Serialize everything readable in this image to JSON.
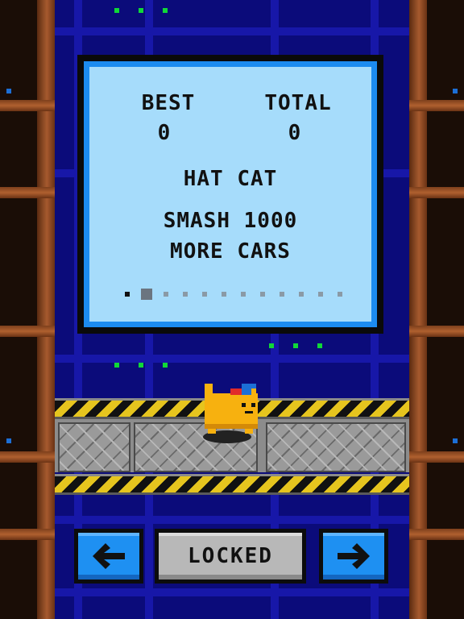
{
  "stats": {
    "best_label": "BEST",
    "best_value": "0",
    "total_label": "TOTAL",
    "total_value": "0"
  },
  "character": {
    "name": "HAT CAT",
    "unlock_line1": "SMASH 1000",
    "unlock_line2": "MORE CARS"
  },
  "pager": {
    "count": 12,
    "current_index": 1
  },
  "controls": {
    "prev_icon": "left-arrow-icon",
    "status_label": "LOCKED",
    "next_icon": "right-arrow-icon"
  },
  "colors": {
    "panel_bg": "#a6dcfb",
    "panel_border": "#1c8cf0",
    "arrow_button": "#1e90f2",
    "locked_button": "#b8b8b8",
    "background": "#0b0b7a",
    "cat_body": "#f7b10f"
  }
}
